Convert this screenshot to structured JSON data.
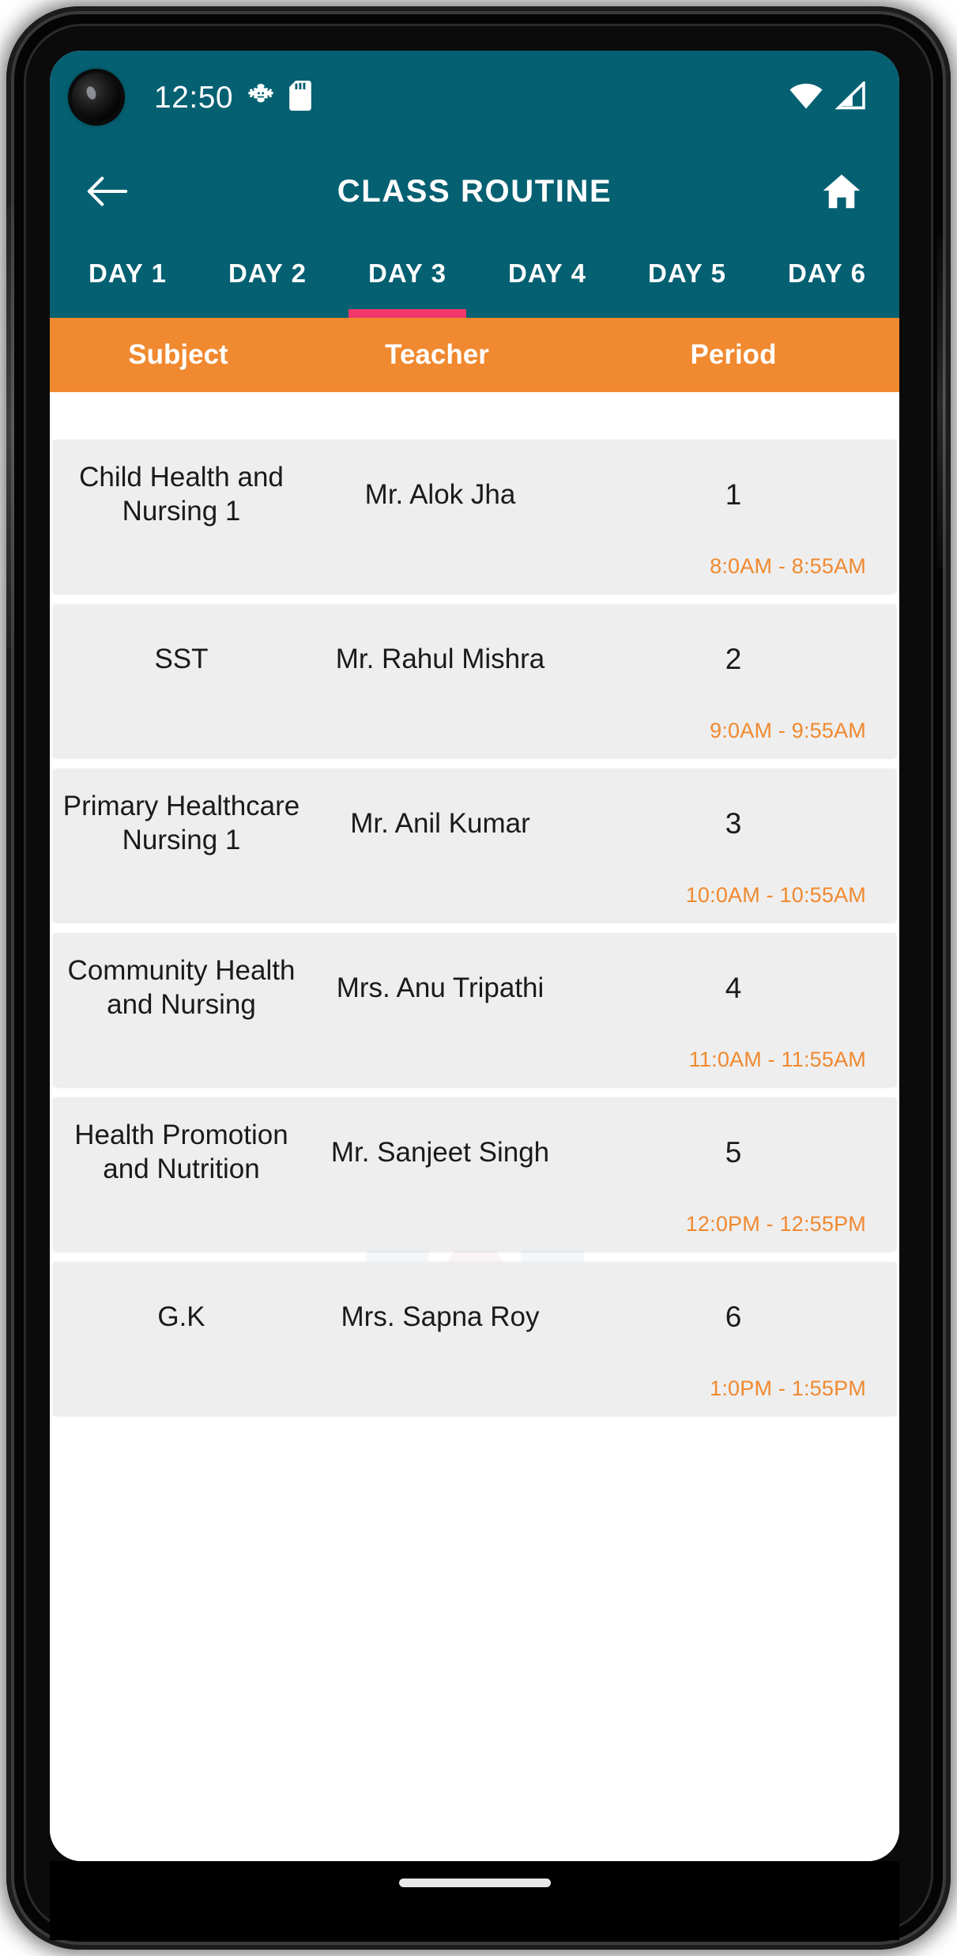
{
  "theme": {
    "primary": "#056072",
    "accent_orange": "#f0892f",
    "tab_indicator": "#f2386b",
    "row_background": "#eeeeee",
    "screen_background": "#ffffff"
  },
  "status_bar": {
    "time": "12:50",
    "icons": [
      "bug-icon",
      "sd-card-icon"
    ],
    "right_icons": [
      "wifi-icon",
      "cellular-signal-icon"
    ]
  },
  "app_bar": {
    "back_icon": "arrow-left-icon",
    "title": "CLASS ROUTINE",
    "home_icon": "home-icon"
  },
  "tabs": {
    "active_index": 2,
    "items": [
      {
        "label": "DAY 1"
      },
      {
        "label": "DAY 2"
      },
      {
        "label": "DAY 3"
      },
      {
        "label": "DAY 4"
      },
      {
        "label": "DAY 5"
      },
      {
        "label": "DAY 6"
      }
    ]
  },
  "table": {
    "columns": {
      "subject": "Subject",
      "teacher": "Teacher",
      "period": "Period"
    },
    "rows": [
      {
        "subject": "Child Health and Nursing 1",
        "teacher": "Mr. Alok Jha",
        "period": "1",
        "time": "8:0AM - 8:55AM"
      },
      {
        "subject": "SST",
        "teacher": "Mr. Rahul Mishra",
        "period": "2",
        "time": "9:0AM - 9:55AM"
      },
      {
        "subject": "Primary Healthcare Nursing 1",
        "teacher": "Mr. Anil Kumar",
        "period": "3",
        "time": "10:0AM - 10:55AM"
      },
      {
        "subject": "Community Health and Nursing",
        "teacher": "Mrs. Anu Tripathi",
        "period": "4",
        "time": "11:0AM - 11:55AM"
      },
      {
        "subject": "Health Promotion and Nutrition",
        "teacher": "Mr. Sanjeet Singh",
        "period": "5",
        "time": "12:0PM - 12:55PM"
      },
      {
        "subject": "G.K",
        "teacher": "Mrs. Sapna Roy",
        "period": "6",
        "time": "1:0PM - 1:55PM"
      }
    ]
  },
  "navigation": {
    "gesture_pill": "home-gesture-pill"
  }
}
